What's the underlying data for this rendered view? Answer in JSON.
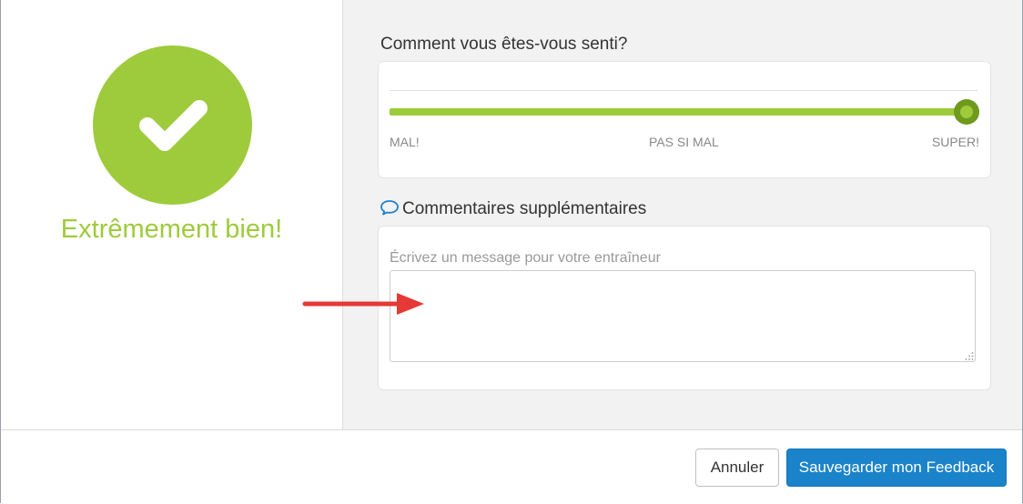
{
  "status": {
    "mood_text": "Extrêmement bien!",
    "accent_color": "#9ecb3c",
    "icon": "checkmark-icon"
  },
  "feeling": {
    "question": "Comment vous êtes-vous senti?",
    "slider_value_fraction": 1.0,
    "labels": {
      "min": "MAL!",
      "mid": "PAS SI MAL",
      "max": "SUPER!"
    }
  },
  "comments": {
    "title": "Commentaires supplémentaires",
    "icon": "chat-bubble-icon",
    "field_label": "Écrivez un message pour votre entraîneur",
    "value": ""
  },
  "footer": {
    "cancel_label": "Annuler",
    "save_label": "Sauvegarder mon Feedback",
    "save_color": "#1b83c9"
  }
}
